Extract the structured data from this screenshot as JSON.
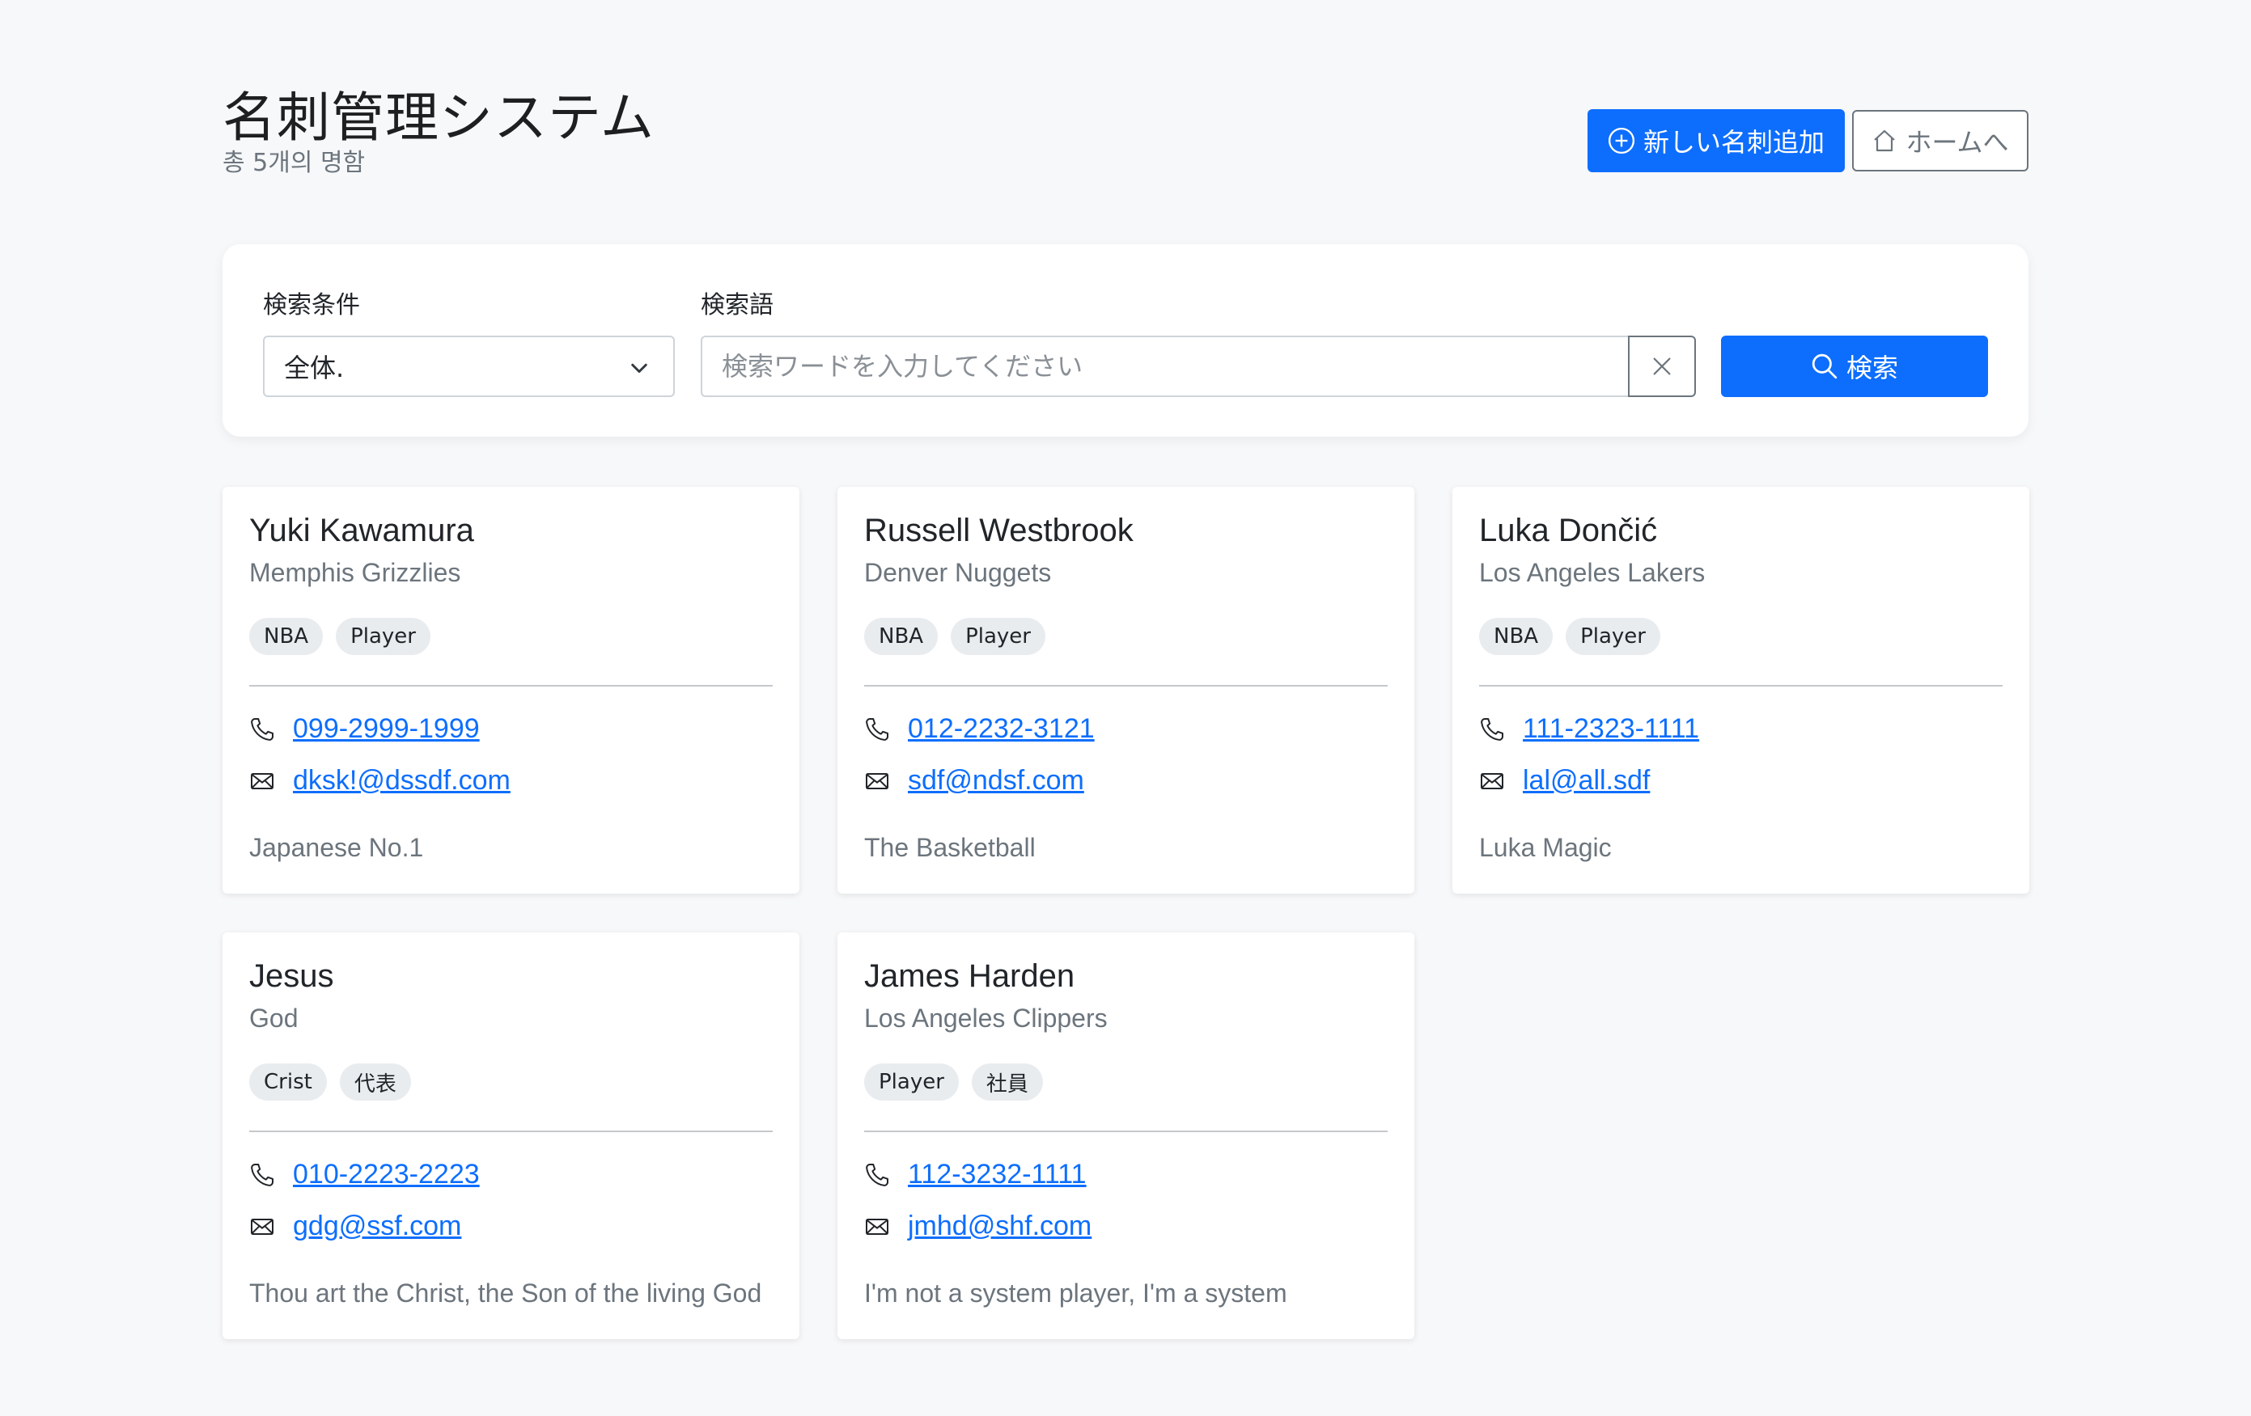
{
  "header": {
    "title": "名刺管理システム",
    "subtitle": "총 5개의 명함",
    "add_button_label": "新しい名刺追加",
    "home_button_label": "ホームへ"
  },
  "search": {
    "condition_label": "検索条件",
    "condition_value": "全体.",
    "term_label": "検索語",
    "placeholder": "検索ワードを入力してください",
    "search_button_label": "検索"
  },
  "cards": [
    {
      "name": "Yuki Kawamura",
      "company": "Memphis Grizzlies",
      "tags": [
        "NBA",
        "Player"
      ],
      "phone": "099-2999-1999",
      "email": "dksk!@dssdf.com",
      "memo": "Japanese No.1"
    },
    {
      "name": "Russell Westbrook",
      "company": "Denver Nuggets",
      "tags": [
        "NBA",
        "Player"
      ],
      "phone": "012-2232-3121",
      "email": "sdf@ndsf.com",
      "memo": "The Basketball"
    },
    {
      "name": "Luka Dončić",
      "company": "Los Angeles Lakers",
      "tags": [
        "NBA",
        "Player"
      ],
      "phone": "111-2323-1111",
      "email": "lal@all.sdf",
      "memo": "Luka Magic"
    },
    {
      "name": "Jesus",
      "company": "God",
      "tags": [
        "Crist",
        "代表"
      ],
      "phone": "010-2223-2223",
      "email": "gdg@ssf.com",
      "memo": "Thou art the Christ, the Son of the living God"
    },
    {
      "name": "James Harden",
      "company": "Los Angeles Clippers",
      "tags": [
        "Player",
        "社員"
      ],
      "phone": "112-3232-1111",
      "email": "jmhd@shf.com",
      "memo": "I'm not a system player, I'm a system"
    }
  ],
  "colors": {
    "primary": "#0d6efd",
    "secondary": "#6c757d",
    "background": "#f7f8fa",
    "tag_background": "#e9ecef"
  }
}
